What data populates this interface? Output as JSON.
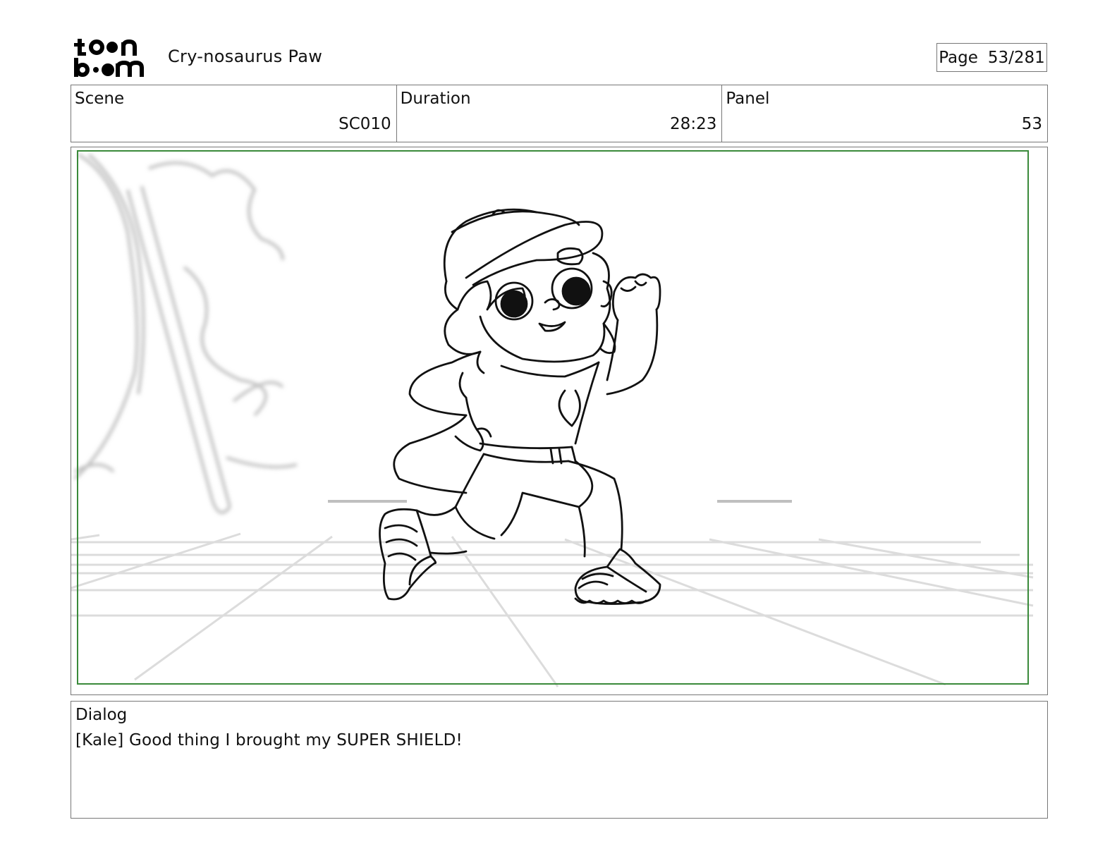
{
  "header": {
    "logo_text": "toon boom",
    "project_title": "Cry-nosaurus Paw",
    "page_label": "Page",
    "page_value": "53/281"
  },
  "info": {
    "scene_label": "Scene",
    "scene_value": "SC010",
    "duration_label": "Duration",
    "duration_value": "28:23",
    "panel_label": "Panel",
    "panel_value": "53"
  },
  "dialog": {
    "label": "Dialog",
    "text": "[Kale] Good thing I brought my SUPER SHIELD!"
  },
  "colors": {
    "safe_frame": "#3a8a3a",
    "border": "#777777",
    "sketch_line": "#111111",
    "background_sketch": "#cfcfcf"
  }
}
